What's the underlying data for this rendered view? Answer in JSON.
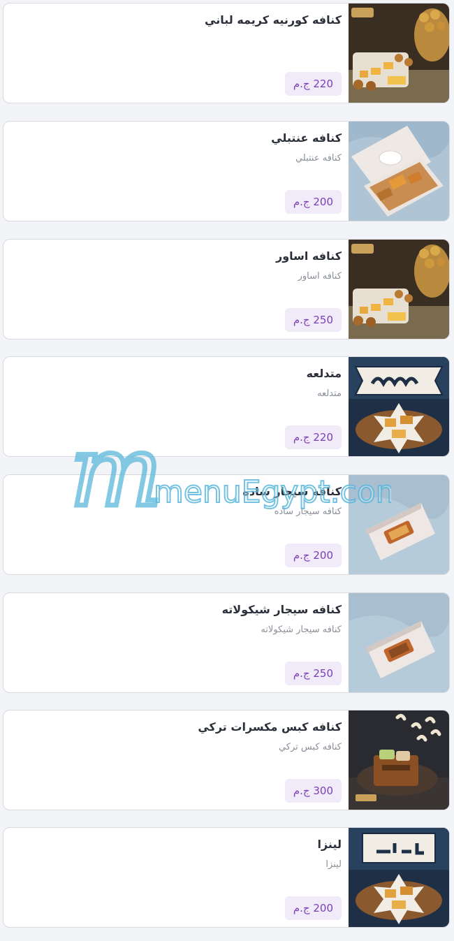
{
  "items": [
    {
      "title": "كنافه كورنيه كريمه لباني",
      "desc": "",
      "price": "220 ج.م",
      "image": "pastry-tray-basket"
    },
    {
      "title": "كنافه عنتبلي",
      "desc": "كنافه عنتبلي",
      "price": "200 ج.م",
      "image": "open-sweets-box"
    },
    {
      "title": "كنافه اساور",
      "desc": "كنافه اساور",
      "price": "250 ج.م",
      "image": "pastry-tray-basket"
    },
    {
      "title": "متدلعه",
      "desc": "متدلعه",
      "price": "220 ج.م",
      "image": "branded-platter"
    },
    {
      "title": "كنافه سيجار ساده",
      "desc": "كنافه سيجار ساده",
      "price": "200 ج.م",
      "image": "closed-sweets-box"
    },
    {
      "title": "كنافه سيجار شيكولاته",
      "desc": "كنافه سيجار شيكولاته",
      "price": "250 ج.م",
      "image": "closed-sweets-box"
    },
    {
      "title": "كنافه كبس مكسرات تركي",
      "desc": "كنافه كبس تركي",
      "price": "300 ج.م",
      "image": "nut-pastry-plate"
    },
    {
      "title": "لينزا",
      "desc": "لينزا",
      "price": "200 ج.م",
      "image": "branded-platter"
    }
  ],
  "watermark": {
    "logo_text": "menuEgypt.com"
  },
  "colors": {
    "price_text": "#7a3fb3",
    "price_bg": "#f1eaf8",
    "card_border": "#d8dae0"
  }
}
